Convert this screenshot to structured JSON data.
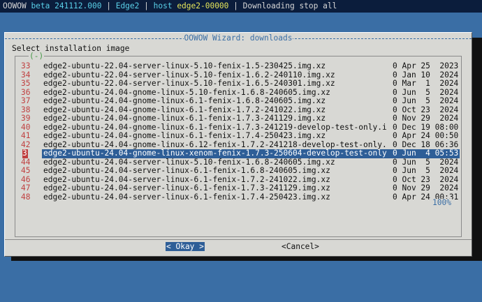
{
  "statusbar": {
    "app": "OOWOW",
    "beta": "beta 241112.000",
    "sep1": " | ",
    "device": "Edge2",
    "sep2": " | ",
    "host_label": "host",
    "host_value": "edge2-00000",
    "sep3": " | ",
    "status": "Downloading stop all"
  },
  "dialog": {
    "title": "OOWOW Wizard: downloads",
    "prompt": "Select installation image",
    "scroll_indicator_top": "(-)",
    "scroll_indicator_bottom": "100%",
    "ok_label": "< Okay >",
    "cancel_label": "<Cancel>"
  },
  "list": [
    {
      "num": "33",
      "name": "edge2-ubuntu-22.04-server-linux-5.10-fenix-1.5-230425.img.xz",
      "meta": "0 Apr 25  2023"
    },
    {
      "num": "34",
      "name": "edge2-ubuntu-22.04-server-linux-5.10-fenix-1.6.2-240110.img.xz",
      "meta": "0 Jan 10  2024"
    },
    {
      "num": "35",
      "name": "edge2-ubuntu-22.04-server-linux-5.10-fenix-1.6.5-240301.img.xz",
      "meta": "0 Mar  1  2024"
    },
    {
      "num": "36",
      "name": "edge2-ubuntu-24.04-gnome-linux-5.10-fenix-1.6.8-240605.img.xz",
      "meta": "0 Jun  5  2024"
    },
    {
      "num": "37",
      "name": "edge2-ubuntu-24.04-gnome-linux-6.1-fenix-1.6.8-240605.img.xz",
      "meta": "0 Jun  5  2024"
    },
    {
      "num": "38",
      "name": "edge2-ubuntu-24.04-gnome-linux-6.1-fenix-1.7.2-241022.img.xz",
      "meta": "0 Oct 23  2024"
    },
    {
      "num": "39",
      "name": "edge2-ubuntu-24.04-gnome-linux-6.1-fenix-1.7.3-241129.img.xz",
      "meta": "0 Nov 29  2024"
    },
    {
      "num": "40",
      "name": "edge2-ubuntu-24.04-gnome-linux-6.1-fenix-1.7.3-241219-develop-test-only.i",
      "meta": "0 Dec 19 08:00"
    },
    {
      "num": "41",
      "name": "edge2-ubuntu-24.04-gnome-linux-6.1-fenix-1.7.4-250423.img.xz",
      "meta": "0 Apr 24 00:50"
    },
    {
      "num": "42",
      "name": "edge2-ubuntu-24.04-gnome-linux-6.12-fenix-1.7.2-241218-develop-test-only.",
      "meta": "0 Dec 18 06:36"
    },
    {
      "num": "3",
      "name": "edge2-ubuntu-24.04-gnome-linux-xenom-fenix-1.7.3-250604-develop-test-only",
      "meta": "0 Jun  4 05:53",
      "selected": true
    },
    {
      "num": "44",
      "name": "edge2-ubuntu-24.04-server-linux-5.10-fenix-1.6.8-240605.img.xz",
      "meta": "0 Jun  5  2024"
    },
    {
      "num": "45",
      "name": "edge2-ubuntu-24.04-server-linux-6.1-fenix-1.6.8-240605.img.xz",
      "meta": "0 Jun  5  2024"
    },
    {
      "num": "46",
      "name": "edge2-ubuntu-24.04-server-linux-6.1-fenix-1.7.2-241022.img.xz",
      "meta": "0 Oct 23  2024"
    },
    {
      "num": "47",
      "name": "edge2-ubuntu-24.04-server-linux-6.1-fenix-1.7.3-241129.img.xz",
      "meta": "0 Nov 29  2024"
    },
    {
      "num": "48",
      "name": "edge2-ubuntu-24.04-server-linux-6.1-fenix-1.7.4-250423.img.xz",
      "meta": "0 Apr 24 00:31"
    }
  ]
}
